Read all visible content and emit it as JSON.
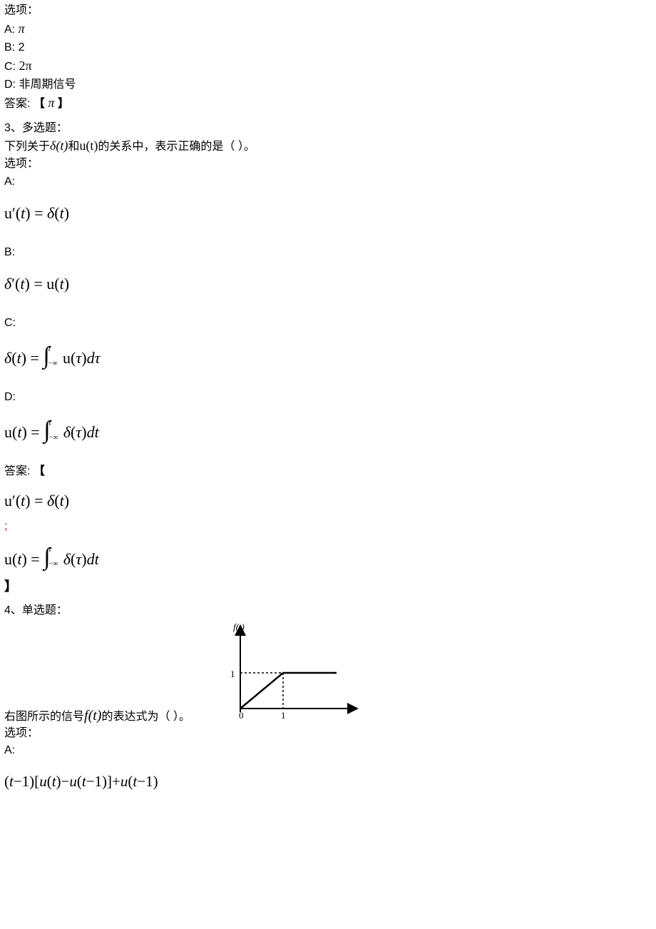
{
  "q2": {
    "options_label": "选项：",
    "A_label": "A:",
    "A_value": "π",
    "B_label": "B:",
    "B_value": "2",
    "C_label": "C:",
    "C_value": "2π",
    "D_label": "D:",
    "D_value": "非周期信号",
    "answer_label": "答案:",
    "answer_open": "【",
    "answer_value": "π",
    "answer_close": "】"
  },
  "q3": {
    "heading": "3、多选题：",
    "stem_pre": "下列关于",
    "stem_delta": "δ(t)",
    "stem_mid": "和",
    "stem_u": "u(t)",
    "stem_post": "的关系中，表示正确的是（  ）。",
    "options_label": "选项：",
    "A_label": "A:",
    "A_formula": "u′(t) = δ(t)",
    "B_label": "B:",
    "B_formula": "δ′(t) = u(t)",
    "C_label": "C:",
    "C_formula": "δ(t) = ∫₋∞ᵗ u(τ)dτ",
    "D_label": "D:",
    "D_formula": "u(t) = ∫₋∞ᵗ δ(τ)dt",
    "answer_label": "答案:",
    "answer_open": "【",
    "answer_1": "u′(t) = δ(t)",
    "sep": ";",
    "answer_2": "u(t) = ∫₋∞ᵗ δ(τ)dt",
    "answer_close": "】"
  },
  "q4": {
    "heading": "4、单选题：",
    "stem_pre": "右图所示的信号",
    "stem_ft": "f(t)",
    "stem_post": "的表达式为（  ）。",
    "options_label": "选项：",
    "A_label": "A:",
    "A_formula": "(t−1)[u(t)−u(t−1)]+u(t−1)",
    "plot": {
      "ylabel": "f(t)",
      "xtick0": "0",
      "xtick1": "1",
      "ytick1": "1"
    }
  }
}
